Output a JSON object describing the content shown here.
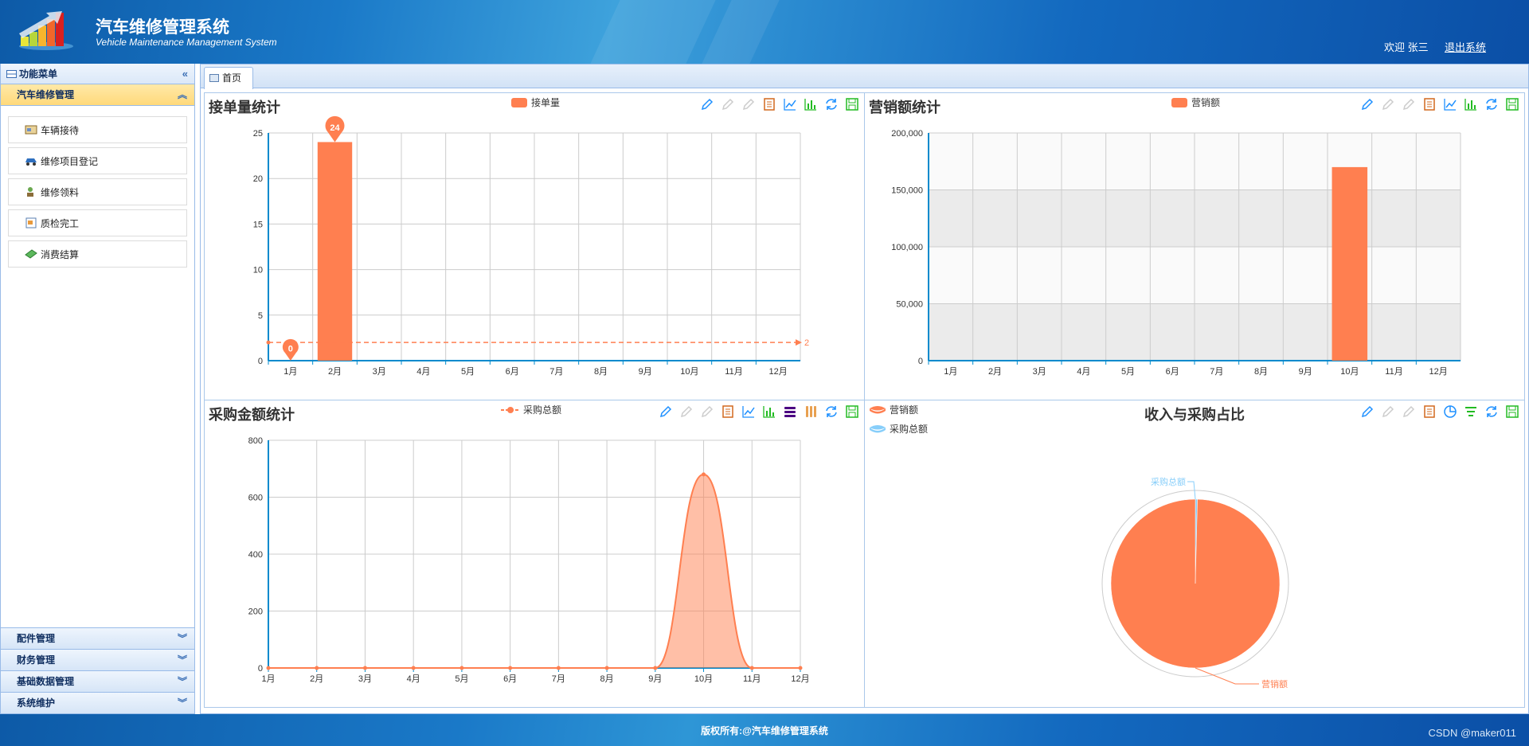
{
  "header": {
    "title": "汽车维修管理系统",
    "subtitle": "Vehicle Maintenance Management System",
    "welcome": "欢迎 张三",
    "logout": "退出系统"
  },
  "sidebar": {
    "panel_title": "功能菜单",
    "active_group": "汽车维修管理",
    "items": [
      {
        "label": "车辆接待",
        "icon": "card-icon"
      },
      {
        "label": "维修项目登记",
        "icon": "car-icon"
      },
      {
        "label": "维修领料",
        "icon": "user-tool-icon"
      },
      {
        "label": "质检完工",
        "icon": "inspection-icon"
      },
      {
        "label": "消费结算",
        "icon": "money-icon"
      }
    ],
    "groups": [
      "配件管理",
      "财务管理",
      "基础数据管理",
      "系统维护"
    ]
  },
  "tabs": [
    {
      "label": "首页"
    }
  ],
  "footer": {
    "copyright": "版权所有:@汽车维修管理系统",
    "watermark": "CSDN @maker011"
  },
  "colors": {
    "series": "#ff7f50",
    "series2": "#87cefa",
    "axis": "#008acd"
  },
  "chart_data": [
    {
      "type": "bar",
      "title": "接单量统计",
      "legend": [
        "接单量"
      ],
      "categories": [
        "1月",
        "2月",
        "3月",
        "4月",
        "5月",
        "6月",
        "7月",
        "8月",
        "9月",
        "10月",
        "11月",
        "12月"
      ],
      "series": [
        {
          "name": "接单量",
          "values": [
            0,
            24,
            0,
            0,
            0,
            0,
            0,
            0,
            0,
            0,
            0,
            0
          ]
        }
      ],
      "ylim": [
        0,
        25
      ],
      "yticks": [
        "0",
        "5",
        "10",
        "15",
        "20",
        "25"
      ],
      "mark_points": [
        {
          "label": "24"
        },
        {
          "label": "0"
        }
      ],
      "mark_line": {
        "label": "2",
        "value": 2
      }
    },
    {
      "type": "bar",
      "title": "营销额统计",
      "legend": [
        "营销额"
      ],
      "categories": [
        "1月",
        "2月",
        "3月",
        "4月",
        "5月",
        "6月",
        "7月",
        "8月",
        "9月",
        "10月",
        "11月",
        "12月"
      ],
      "series": [
        {
          "name": "营销额",
          "values": [
            0,
            0,
            0,
            0,
            0,
            0,
            0,
            0,
            0,
            170000,
            0,
            0
          ]
        }
      ],
      "ylim": [
        0,
        200000
      ],
      "yticks": [
        "0",
        "50,000",
        "100,000",
        "150,000",
        "200,000"
      ]
    },
    {
      "type": "area",
      "title": "采购金额统计",
      "legend": [
        "采购总额"
      ],
      "categories": [
        "1月",
        "2月",
        "3月",
        "4月",
        "5月",
        "6月",
        "7月",
        "8月",
        "9月",
        "10月",
        "11月",
        "12月"
      ],
      "series": [
        {
          "name": "采购总额",
          "values": [
            0,
            0,
            0,
            0,
            0,
            0,
            0,
            0,
            0,
            680,
            0,
            0
          ]
        }
      ],
      "ylim": [
        0,
        800
      ],
      "yticks": [
        "0",
        "200",
        "400",
        "600",
        "800"
      ]
    },
    {
      "type": "pie",
      "title": "收入与采购占比",
      "legend": [
        "营销额",
        "采购总额"
      ],
      "series": [
        {
          "name": "收入与采购占比",
          "slices": [
            {
              "label": "营销额",
              "value": 170000
            },
            {
              "label": "采购总额",
              "value": 680
            }
          ]
        }
      ]
    }
  ]
}
